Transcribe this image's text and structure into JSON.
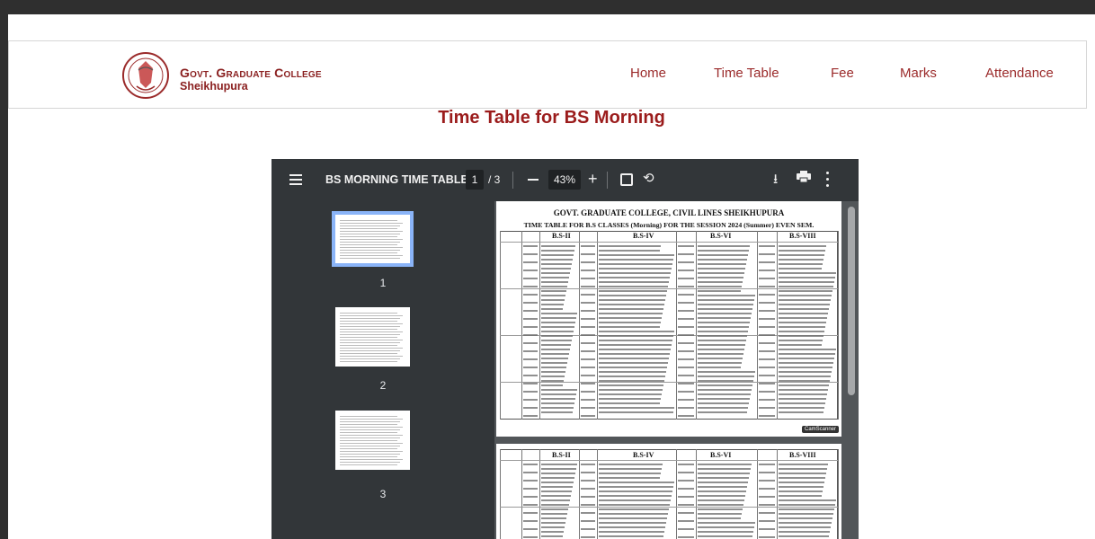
{
  "header": {
    "brand_line1": "Govt. Graduate College",
    "brand_line2": "Sheikhupura",
    "nav": [
      "Home",
      "Time Table",
      "Fee",
      "Marks",
      "Attendance"
    ]
  },
  "page_title": "Time Table for BS Morning",
  "viewer": {
    "doc_title": "BS MORNING TIME TABLE",
    "current_page": "1",
    "page_total": "/ 3",
    "zoom": "43%",
    "thumbnails": [
      "1",
      "2",
      "3"
    ],
    "page1_heading": "GOVT. GRADUATE COLLEGE, CIVIL LINES SHEIKHUPURA",
    "page1_subheading": "TIME TABLE FOR B.S CLASSES (Morning) FOR THE SESSION 2024 (Summer) EVEN SEM.",
    "columns": [
      "B.S-II",
      "B.S-IV",
      "B.S-VI",
      "B.S-VIII"
    ],
    "scanner_badge": "CamScanner"
  },
  "colors": {
    "brand": "#8a1f1f",
    "title": "#9b1c1c",
    "viewer_toolbar": "#323639",
    "viewer_bg": "#525659",
    "selected_thumb": "#8ab4f8"
  }
}
